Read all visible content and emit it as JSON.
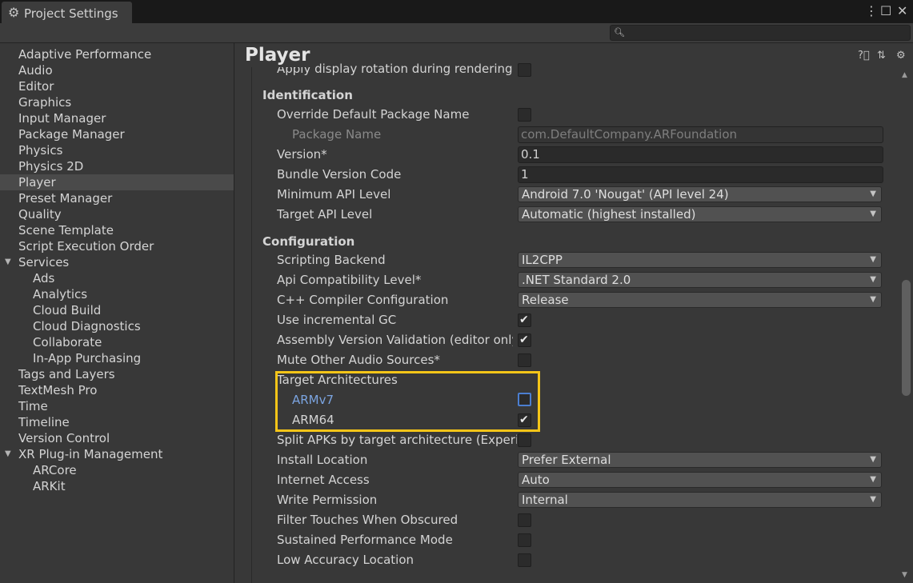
{
  "window": {
    "title": "Project Settings",
    "icons": {
      "tab": "gear-icon",
      "menu": "kebab-menu-icon",
      "maximize": "maximize-icon",
      "close": "close-icon"
    }
  },
  "search": {
    "placeholder": "",
    "icon": "search-icon"
  },
  "sidebar": {
    "items": [
      "Adaptive Performance",
      "Audio",
      "Editor",
      "Graphics",
      "Input Manager",
      "Package Manager",
      "Physics",
      "Physics 2D",
      "Player",
      "Preset Manager",
      "Quality",
      "Scene Template",
      "Script Execution Order",
      "Services"
    ],
    "services_children": [
      "Ads",
      "Analytics",
      "Cloud Build",
      "Cloud Diagnostics",
      "Collaborate",
      "In-App Purchasing"
    ],
    "items_after": [
      "Tags and Layers",
      "TextMesh Pro",
      "Time",
      "Timeline",
      "Version Control",
      "XR Plug-in Management"
    ],
    "xr_children": [
      "ARCore",
      "ARKit"
    ],
    "selected": "Player"
  },
  "header": {
    "title": "Player",
    "icons": {
      "help": "help-icon",
      "presets": "presets-icon",
      "settings": "settings-gear-icon"
    }
  },
  "settings": {
    "partial_top_label": "Apply display rotation during rendering",
    "identification": {
      "heading": "Identification",
      "override_pkg_label": "Override Default Package Name",
      "package_name_label": "Package Name",
      "package_name_value": "com.DefaultCompany.ARFoundation",
      "version_label": "Version*",
      "version_value": "0.1",
      "bundle_code_label": "Bundle Version Code",
      "bundle_code_value": "1",
      "min_api_label": "Minimum API Level",
      "min_api_value": "Android 7.0 'Nougat' (API level 24)",
      "target_api_label": "Target API Level",
      "target_api_value": "Automatic (highest installed)"
    },
    "configuration": {
      "heading": "Configuration",
      "scripting_backend_label": "Scripting Backend",
      "scripting_backend_value": "IL2CPP",
      "api_compat_label": "Api Compatibility Level*",
      "api_compat_value": ".NET Standard 2.0",
      "cpp_config_label": "C++ Compiler Configuration",
      "cpp_config_value": "Release",
      "incremental_gc_label": "Use incremental GC",
      "incremental_gc_checked": true,
      "assembly_validation_label": "Assembly Version Validation (editor only)",
      "assembly_validation_checked": true,
      "mute_audio_label": "Mute Other Audio Sources*",
      "mute_audio_checked": false,
      "target_arch_label": "Target Architectures",
      "armv7_label": "ARMv7",
      "armv7_checked": false,
      "arm64_label": "ARM64",
      "arm64_checked": true,
      "split_apks_label": "Split APKs by target architecture (Experim",
      "split_apks_checked": false,
      "install_location_label": "Install Location",
      "install_location_value": "Prefer External",
      "internet_access_label": "Internet Access",
      "internet_access_value": "Auto",
      "write_permission_label": "Write Permission",
      "write_permission_value": "Internal",
      "filter_touches_label": "Filter Touches When Obscured",
      "sustained_perf_label": "Sustained Performance Mode",
      "low_accuracy_label": "Low Accuracy Location"
    }
  },
  "colors": {
    "highlight": "#f5c518",
    "focus_label": "#7ba4e0",
    "selected_row": "#4a4a4a",
    "background": "#383838"
  }
}
